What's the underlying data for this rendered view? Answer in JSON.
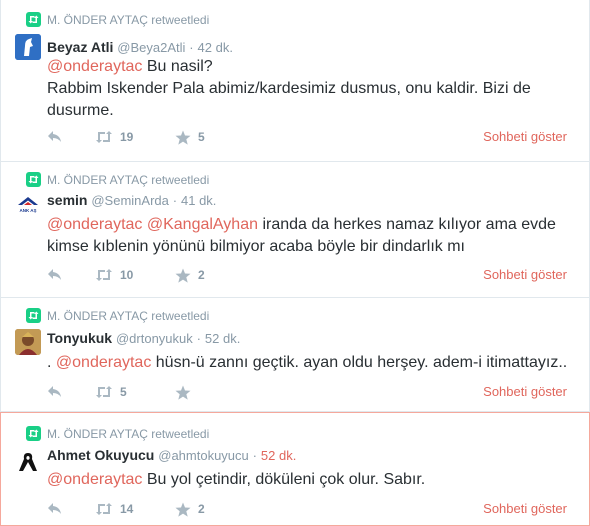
{
  "colors": {
    "accent": "#e0665c",
    "muted": "#8899a6",
    "retweet_green": "#19cf86"
  },
  "tweets": [
    {
      "retweeted_by": "M. ÖNDER AYTAÇ retweetledi",
      "fullname": "Beyaz Atli",
      "handle": "@Beya2Atli",
      "time": "42 dk.",
      "mentions": [
        "@onderaytac"
      ],
      "text": "Bu nasil?",
      "text_line2": "Rabbim Iskender Pala abimiz/kardesimiz dusmus, onu kaldir. Bizi de",
      "text_line3": "dusurme.",
      "retweets": "19",
      "favorites": "5",
      "show_conversation": "Sohbeti göster",
      "avatar_icon": "white-horse-logo"
    },
    {
      "retweeted_by": "M. ÖNDER AYTAÇ retweetledi",
      "fullname": "semin",
      "handle": "@SeminArda",
      "time": "41 dk.",
      "mentions": [
        "@onderaytac",
        "@KangalAyhan"
      ],
      "text": "iranda da herkes namaz kılıyor ama evde",
      "text_line2": "kimse kıblenin yönünü bilmiyor acaba böyle bir dindarlık mı",
      "retweets": "10",
      "favorites": "2",
      "show_conversation": "Sohbeti göster",
      "avatar_icon": "ank-logo",
      "avatar_text": "ANK AŞ"
    },
    {
      "retweeted_by": "M. ÖNDER AYTAÇ retweetledi",
      "fullname": "Tonyukuk",
      "handle": "@drtonyukuk",
      "time": "52 dk.",
      "prefix": ".",
      "mentions": [
        "@onderaytac"
      ],
      "text": "hüsn-ü zannı geçtik. ayan oldu herşey. adem-i itimattayız..",
      "retweets": "5",
      "favorites": "",
      "show_conversation": "Sohbeti göster",
      "avatar_icon": "portrait-avatar"
    },
    {
      "retweeted_by": "M. ÖNDER AYTAÇ retweetledi",
      "fullname": "Ahmet Okuyucu",
      "handle": "@ahmtokuyucu",
      "time": "52 dk.",
      "mentions": [
        "@onderaytac"
      ],
      "text": "Bu yol çetindir, döküleni çok olur. Sabır.",
      "retweets": "14",
      "favorites": "2",
      "show_conversation": "Sohbeti göster",
      "avatar_icon": "black-ribbon-avatar"
    }
  ]
}
